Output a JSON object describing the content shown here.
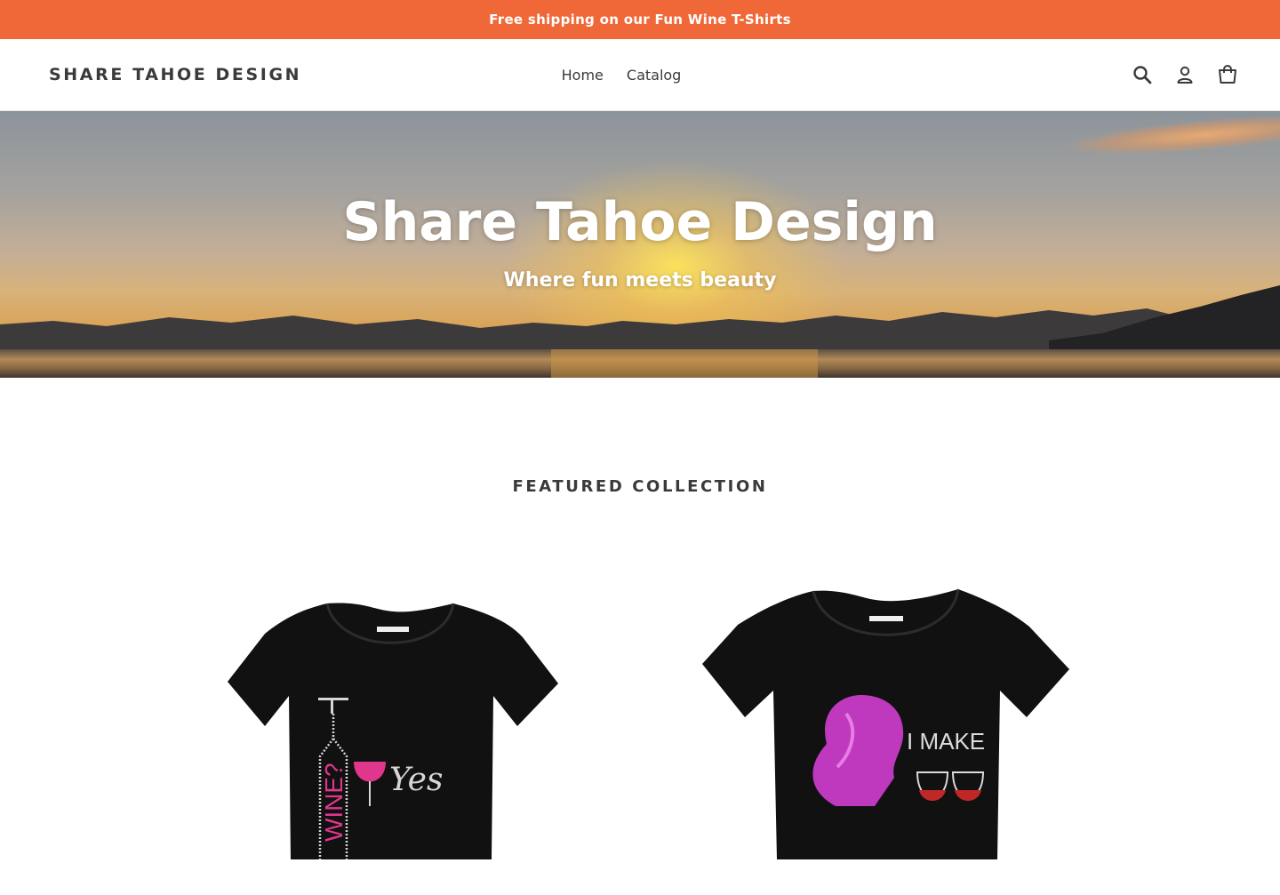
{
  "announcement": {
    "text": "Free shipping on our Fun Wine T-Shirts",
    "background_color": "#f06838"
  },
  "header": {
    "logo": "SHARE TAHOE DESIGN",
    "nav": [
      {
        "label": "Home"
      },
      {
        "label": "Catalog"
      }
    ],
    "icons": [
      "search-icon",
      "account-icon",
      "cart-icon"
    ]
  },
  "hero": {
    "title": "Share Tahoe Design",
    "subtitle": "Where fun meets beauty"
  },
  "featured": {
    "title": "FEATURED COLLECTION",
    "products": [
      {
        "shirt_text": [
          "WINE?",
          "Yes"
        ],
        "shirt_color": "#111111",
        "print_colors": [
          "#e0368c",
          "#d8d8d8"
        ]
      },
      {
        "shirt_text": [
          "I MAKE"
        ],
        "shirt_color": "#111111",
        "print_colors": [
          "#c83cc8",
          "#c02828",
          "#e0e0e0"
        ]
      }
    ]
  }
}
